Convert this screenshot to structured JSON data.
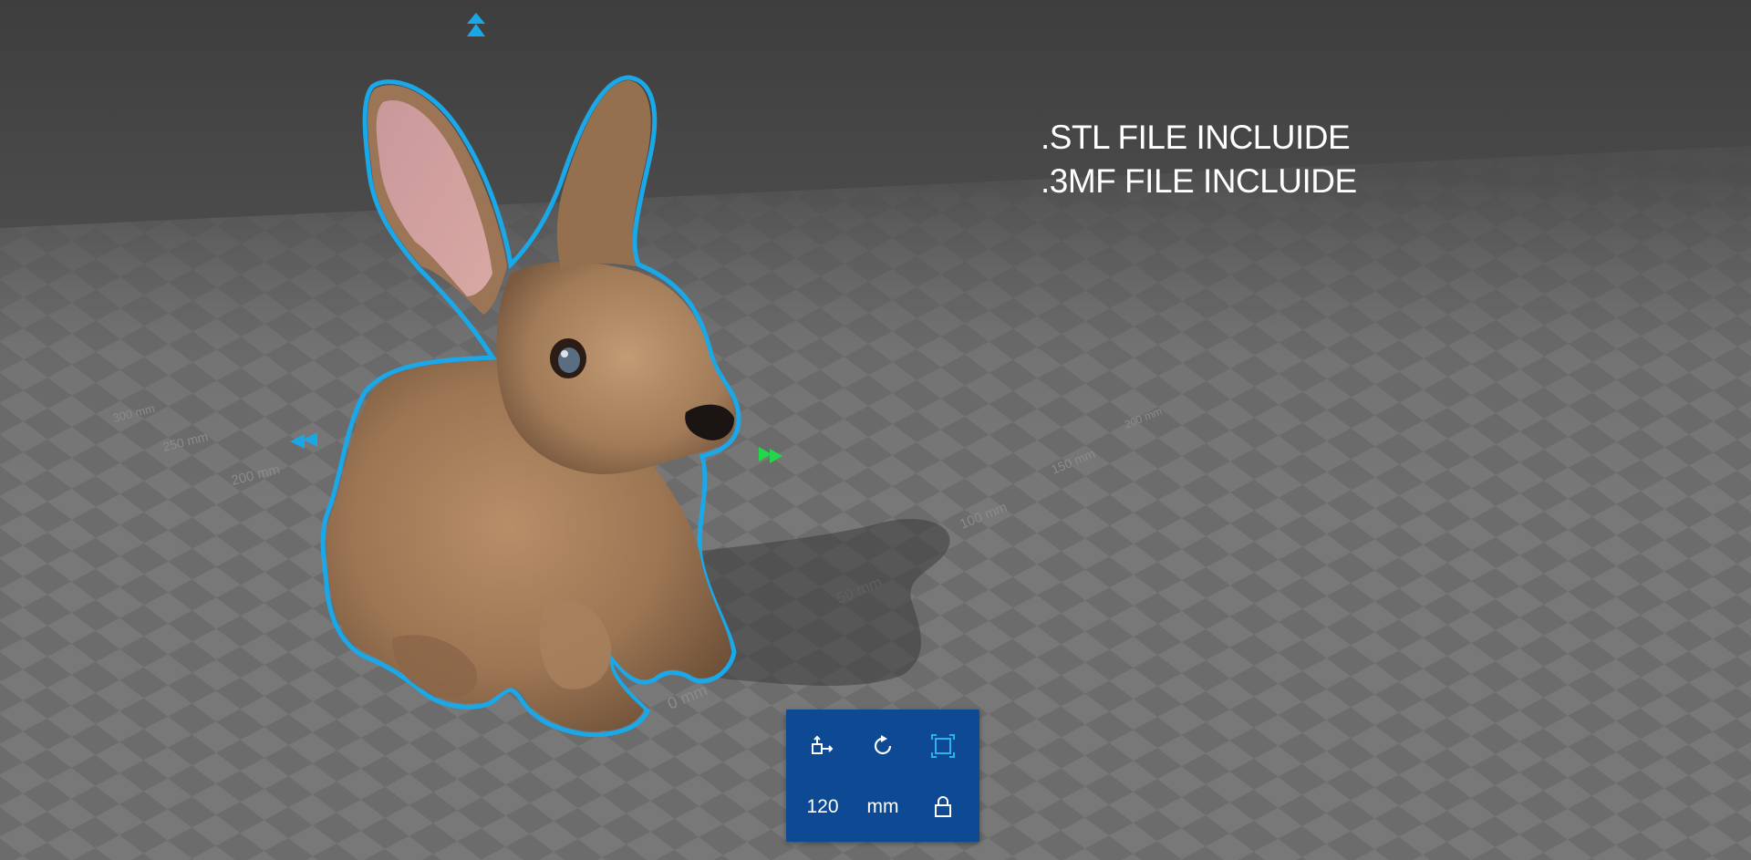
{
  "info": {
    "line1": ".STL FILE INCLUIDE",
    "line2": ".3MF FILE INCLUIDE"
  },
  "scene": {
    "model": "rabbit",
    "outline_color": "#1aa8e8",
    "handle_color_blue": "#19a7e6",
    "handle_color_green": "#22d84a",
    "axis_labels_front": [
      "0 mm",
      "50 mm",
      "100 mm",
      "150 mm",
      "200 mm"
    ],
    "axis_labels_left": [
      "200 mm",
      "250 mm",
      "300 mm"
    ]
  },
  "toolbar": {
    "background": "#0e4a94",
    "active_color": "#2ab3f0",
    "move_icon": "move-icon",
    "rotate_icon": "rotate-icon",
    "scale_icon": "scale-icon",
    "size_value": "120",
    "unit": "mm",
    "lock_icon": "lock-icon"
  }
}
